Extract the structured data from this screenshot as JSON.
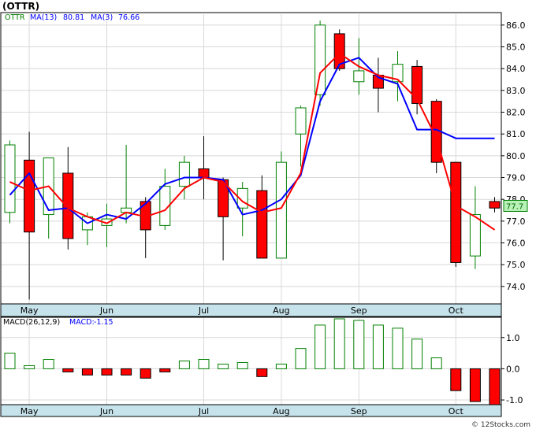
{
  "title": "(OTTR)",
  "credit": "© 12Stocks.com",
  "colors": {
    "up": "#008000",
    "down": "#ff0000",
    "ma13": "#0000ff",
    "ma3": "#ff0000",
    "axisBand": "#c6e3ec",
    "grid": "#d8d8d8",
    "price_tag_bg": "#b9f2b9",
    "price_tag_fg": "#006600"
  },
  "price_panel": {
    "legend": {
      "symbol": "OTTR",
      "ma13_label": "MA(13)",
      "ma13_value": "80.81",
      "ma3_label": "MA(3)",
      "ma3_value": "76.66"
    },
    "last_price": "77.7"
  },
  "macd_panel": {
    "legend": {
      "label": "MACD(26,12,9)",
      "macd_label": "MACD:",
      "macd_value": "-1.15"
    }
  },
  "chart_data": [
    {
      "type": "candlestick",
      "title": "(OTTR)",
      "x_labels": [
        "May",
        "Jun",
        "Jul",
        "Aug",
        "Sep",
        "Oct"
      ],
      "x_label_index": [
        1,
        5,
        10,
        14,
        18,
        23
      ],
      "ylim": [
        73.2,
        86.5
      ],
      "yticks": [
        74.0,
        75.0,
        76.0,
        77.0,
        78.0,
        79.0,
        80.0,
        81.0,
        82.0,
        83.0,
        84.0,
        85.0,
        86.0
      ],
      "grid": true,
      "candles": [
        {
          "o": 77.4,
          "h": 80.7,
          "l": 76.9,
          "c": 80.5
        },
        {
          "o": 79.8,
          "h": 81.1,
          "l": 73.4,
          "c": 76.5
        },
        {
          "o": 77.3,
          "h": 79.9,
          "l": 76.2,
          "c": 79.9
        },
        {
          "o": 79.2,
          "h": 80.4,
          "l": 75.7,
          "c": 76.2
        },
        {
          "o": 76.6,
          "h": 77.4,
          "l": 75.9,
          "c": 77.2
        },
        {
          "o": 76.8,
          "h": 77.8,
          "l": 75.8,
          "c": 77.1
        },
        {
          "o": 77.4,
          "h": 80.5,
          "l": 76.9,
          "c": 77.6
        },
        {
          "o": 77.9,
          "h": 78.1,
          "l": 75.3,
          "c": 76.6
        },
        {
          "o": 76.8,
          "h": 79.4,
          "l": 76.6,
          "c": 78.6
        },
        {
          "o": 78.6,
          "h": 80.0,
          "l": 78.0,
          "c": 79.7
        },
        {
          "o": 79.4,
          "h": 80.9,
          "l": 78.0,
          "c": 79.0
        },
        {
          "o": 78.9,
          "h": 79.0,
          "l": 75.2,
          "c": 77.2
        },
        {
          "o": 77.6,
          "h": 78.8,
          "l": 76.3,
          "c": 78.5
        },
        {
          "o": 78.4,
          "h": 79.1,
          "l": 75.3,
          "c": 75.3
        },
        {
          "o": 75.3,
          "h": 80.2,
          "l": 75.3,
          "c": 79.7
        },
        {
          "o": 81.0,
          "h": 82.3,
          "l": 79.5,
          "c": 82.2
        },
        {
          "o": 82.8,
          "h": 86.2,
          "l": 82.3,
          "c": 86.0
        },
        {
          "o": 85.6,
          "h": 85.8,
          "l": 83.9,
          "c": 84.0
        },
        {
          "o": 83.4,
          "h": 85.4,
          "l": 82.8,
          "c": 83.9
        },
        {
          "o": 83.7,
          "h": 84.5,
          "l": 82.0,
          "c": 83.1
        },
        {
          "o": 83.4,
          "h": 84.8,
          "l": 82.5,
          "c": 84.2
        },
        {
          "o": 84.1,
          "h": 84.4,
          "l": 81.9,
          "c": 82.4
        },
        {
          "o": 82.5,
          "h": 82.6,
          "l": 79.2,
          "c": 79.7
        },
        {
          "o": 79.7,
          "h": 79.7,
          "l": 74.9,
          "c": 75.1
        },
        {
          "o": 75.4,
          "h": 78.6,
          "l": 74.8,
          "c": 77.3
        },
        {
          "o": 77.9,
          "h": 78.1,
          "l": 77.4,
          "c": 77.6
        }
      ],
      "series": [
        {
          "name": "MA(13)",
          "color": "#0000ff",
          "start": 1,
          "values": [
            78.2,
            79.2,
            77.5,
            77.6,
            76.9,
            77.3,
            77.1,
            77.8,
            78.7,
            79.0,
            79.0,
            78.9,
            77.3,
            77.5,
            78.0,
            79.1,
            82.5,
            84.2,
            84.5,
            83.6,
            83.3,
            81.2,
            81.2,
            80.8,
            80.8,
            80.8
          ]
        },
        {
          "name": "MA(3)",
          "color": "#ff0000",
          "start": 0,
          "values": [
            78.8,
            78.4,
            78.6,
            77.6,
            77.2,
            76.9,
            77.4,
            77.2,
            77.5,
            78.5,
            79.0,
            78.8,
            77.9,
            77.4,
            77.6,
            79.2,
            83.8,
            84.7,
            84.1,
            83.7,
            83.5,
            82.6,
            80.8,
            77.7,
            77.2,
            76.6
          ],
          "values_offset": 0
        }
      ]
    },
    {
      "type": "bar",
      "title": "MACD(26,12,9)",
      "ylim": [
        -1.15,
        1.65
      ],
      "yticks": [
        -1.0,
        0.0,
        1.0
      ],
      "x_labels": [
        "May",
        "Jun",
        "Jul",
        "Aug",
        "Sep",
        "Oct"
      ],
      "values": [
        0.5,
        0.1,
        0.3,
        -0.1,
        -0.2,
        -0.2,
        -0.2,
        -0.3,
        -0.1,
        0.25,
        0.3,
        0.15,
        0.2,
        -0.25,
        0.15,
        0.65,
        1.4,
        1.6,
        1.55,
        1.4,
        1.3,
        0.95,
        0.35,
        -0.7,
        -1.05,
        -1.15
      ]
    }
  ]
}
